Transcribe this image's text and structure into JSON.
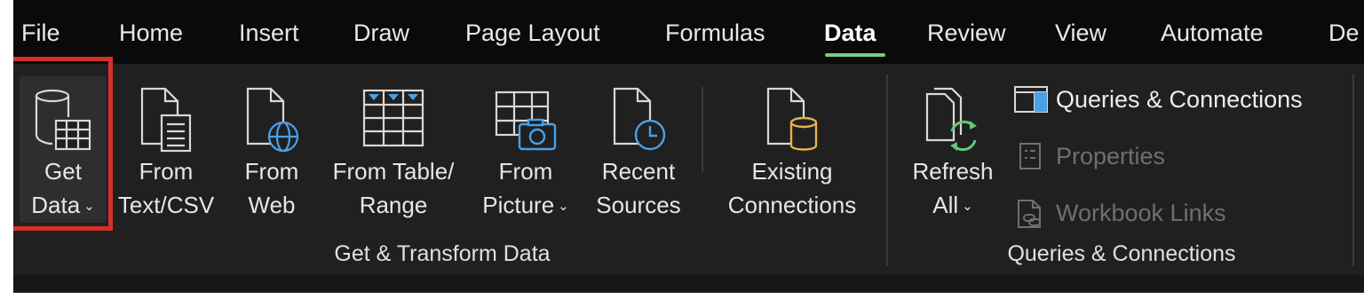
{
  "tabs": [
    {
      "label": "File",
      "active": false
    },
    {
      "label": "Home",
      "active": false
    },
    {
      "label": "Insert",
      "active": false
    },
    {
      "label": "Draw",
      "active": false
    },
    {
      "label": "Page Layout",
      "active": false
    },
    {
      "label": "Formulas",
      "active": false
    },
    {
      "label": "Data",
      "active": true
    },
    {
      "label": "Review",
      "active": false
    },
    {
      "label": "View",
      "active": false
    },
    {
      "label": "Automate",
      "active": false
    },
    {
      "label": "De",
      "active": false
    }
  ],
  "accent_color": "#7cc88a",
  "highlight_color": "#d7302b",
  "get_transform": {
    "group_label": "Get & Transform Data",
    "get_data": {
      "line1": "Get",
      "line2": "Data",
      "icon": "database-table-icon",
      "has_dropdown": true
    },
    "from_text_csv": {
      "line1": "From",
      "line2": "Text/CSV",
      "icon": "text-document-icon"
    },
    "from_web": {
      "line1": "From",
      "line2": "Web",
      "icon": "web-document-icon"
    },
    "from_table_range": {
      "line1": "From Table/",
      "line2": "Range",
      "icon": "table-grid-icon"
    },
    "from_picture": {
      "line1": "From",
      "line2": "Picture",
      "icon": "camera-table-icon",
      "has_dropdown": true
    },
    "recent_sources": {
      "line1": "Recent",
      "line2": "Sources",
      "icon": "clock-document-icon"
    },
    "existing_connections": {
      "line1": "Existing",
      "line2": "Connections",
      "icon": "database-document-icon"
    }
  },
  "queries_connections": {
    "group_label": "Queries & Connections",
    "refresh_all": {
      "line1": "Refresh",
      "line2": "All",
      "icon": "refresh-icon",
      "has_dropdown": true
    },
    "queries_connections_btn": {
      "label": "Queries & Connections",
      "icon": "panel-icon",
      "enabled": true
    },
    "properties": {
      "label": "Properties",
      "icon": "properties-icon",
      "enabled": false
    },
    "workbook_links": {
      "label": "Workbook Links",
      "icon": "link-document-icon",
      "enabled": false
    }
  }
}
